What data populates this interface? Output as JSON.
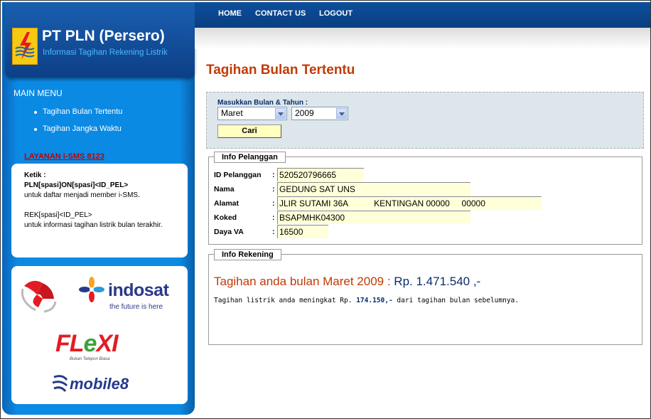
{
  "brand": {
    "title": "PT PLN (Persero)",
    "subtitle": "Informasi Tagihan Rekening Listrik"
  },
  "menu": {
    "title": "MAIN MENU",
    "items": [
      "Tagihan Bulan Tertentu",
      "Tagihan Jangka Waktu"
    ]
  },
  "sms": {
    "title": "LAYANAN i-SMS 8123",
    "lines": {
      "l1": "Ketik :",
      "l2": "PLN[spasi]ON[spasi]<ID_PEL>",
      "l3": "untuk daftar menjadi member i-SMS.",
      "l4": "REK[spasi]<ID_PEL>",
      "l5": "untuk informasi tagihan listrik bulan terakhir."
    }
  },
  "partners": {
    "indosat": "indosat",
    "indosat_tag": "the future is here",
    "flexi_a": "FL",
    "flexi_b": "e",
    "flexi_c": "XI",
    "flexi_tag": "Bukan Telepon Biasa",
    "mobile8": "mobile8"
  },
  "nav": {
    "home": "HOME",
    "contact": "CONTACT US",
    "logout": "LOGOUT"
  },
  "page": {
    "title": "Tagihan Bulan Tertentu"
  },
  "search": {
    "label": "Masukkan Bulan & Tahun :",
    "month": "Maret",
    "year": "2009",
    "button": "Cari"
  },
  "pelanggan": {
    "legend": "Info Pelanggan",
    "colon": ":",
    "id_label": "ID Pelanggan",
    "id_value": "520520796665",
    "nama_label": "Nama",
    "nama_value": "GEDUNG SAT UNS",
    "alamat_label": "Alamat",
    "alamat_value": "JLIR SUTAMI 36A           KENTINGAN 00000     00000",
    "koked_label": "Koked",
    "koked_value": "BSAPMHK04300",
    "daya_label": "Daya VA",
    "daya_value": "16500"
  },
  "rekening": {
    "legend": "Info Rekening",
    "heading_text": "Tagihan anda bulan Maret 2009 :",
    "heading_amount": " Rp. 1.471.540 ,-",
    "note_a": "Tagihan listrik anda meningkat Rp. ",
    "note_amount": "174.150,-",
    "note_b": " dari tagihan bulan sebelumnya."
  },
  "colors": {
    "title_red": "#c23a06",
    "navy": "#0a2c6b",
    "sidebar_blue": "#0b8ae4"
  }
}
